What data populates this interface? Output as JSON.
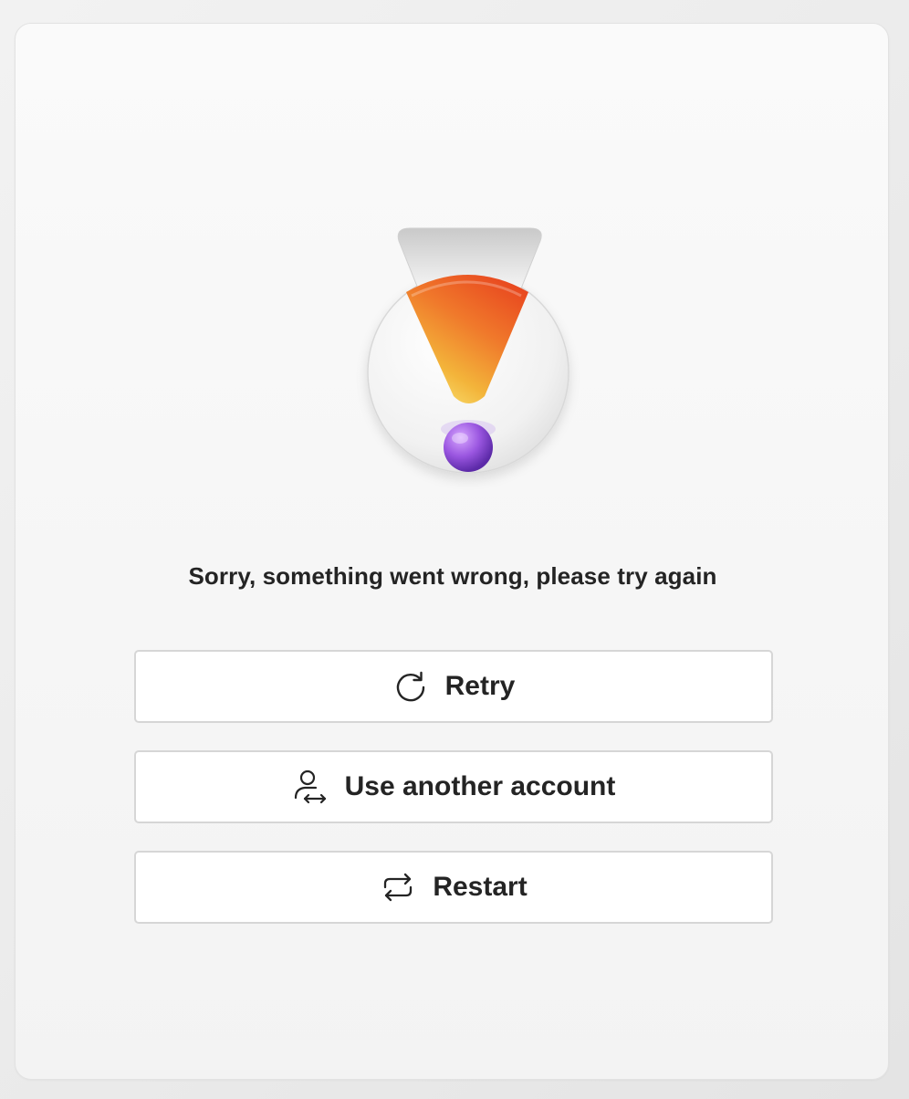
{
  "dialog": {
    "message": "Sorry, something went wrong, please try again",
    "illustration": "warning-exclamation-icon"
  },
  "buttons": {
    "retry": {
      "label": "Retry",
      "icon": "refresh-icon"
    },
    "another_account": {
      "label": "Use another account",
      "icon": "switch-account-icon"
    },
    "restart": {
      "label": "Restart",
      "icon": "restart-icon"
    }
  },
  "colors": {
    "text": "#242424",
    "button_border": "#d6d6d6",
    "button_background": "#ffffff",
    "exclamation_top": "#f05a28",
    "exclamation_bottom": "#f7d14a",
    "dot": "#8a4fd6"
  }
}
